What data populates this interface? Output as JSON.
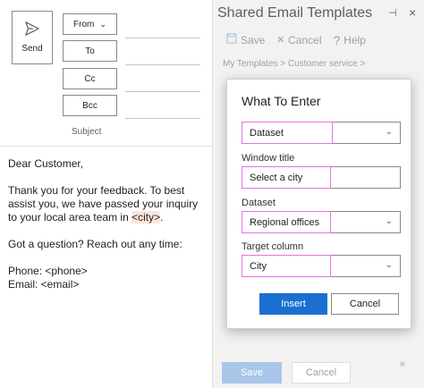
{
  "compose": {
    "send_label": "Send",
    "from_label": "From",
    "to_label": "To",
    "cc_label": "Cc",
    "bcc_label": "Bcc",
    "subject_label": "Subject",
    "body": {
      "greeting": "Dear Customer,",
      "para1_before": "Thank you for your feedback. To best assist you, we have passed your inquiry to your local area team in ",
      "para1_placeholder": "<city>",
      "para1_after": ".",
      "para2": "Got a question? Reach out any time:",
      "phone_line": "Phone: <phone>",
      "email_line": "Email: <email>"
    }
  },
  "pane": {
    "title": "Shared Email Templates",
    "toolbar": {
      "save_label": "Save",
      "cancel_label": "Cancel",
      "help_label": "Help"
    },
    "breadcrumb": "My Templates > Customer service >",
    "bottom_save_label": "Save",
    "bottom_cancel_label": "Cancel"
  },
  "dialog": {
    "title": "What To Enter",
    "type_value": "Dataset",
    "window_title_label": "Window title",
    "window_title_value": "Select a city",
    "dataset_label": "Dataset",
    "dataset_value": "Regional offices",
    "target_column_label": "Target column",
    "target_column_value": "City",
    "insert_label": "Insert",
    "cancel_label": "Cancel"
  },
  "colors": {
    "accent": "#1a6fd0",
    "highlight": "#e373e6",
    "placeholder_bg": "#fde7dc"
  },
  "icons": [
    "send-icon",
    "chevron-down-icon",
    "save-icon",
    "cancel-x-icon",
    "help-icon",
    "pin-icon",
    "close-icon"
  ]
}
